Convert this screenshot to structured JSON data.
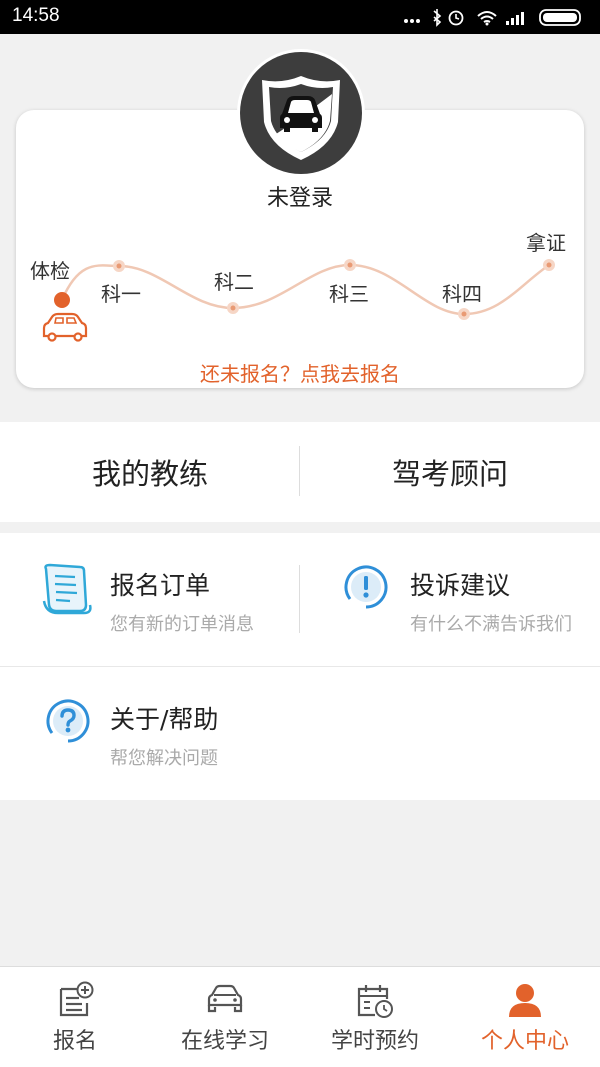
{
  "status_bar": {
    "time": "14:58"
  },
  "profile": {
    "login_status": "未登录",
    "signup_prompt": "还未报名？点我去报名"
  },
  "progress": {
    "stages": [
      "体检",
      "科一",
      "科二",
      "科三",
      "科四",
      "拿证"
    ],
    "current_stage_index": 0
  },
  "quick_buttons": {
    "coach": "我的教练",
    "advisor": "驾考顾问"
  },
  "menu": {
    "orders": {
      "title": "报名订单",
      "subtitle": "您有新的订单消息"
    },
    "complaints": {
      "title": "投诉建议",
      "subtitle": "有什么不满告诉我们"
    },
    "help": {
      "title": "关于/帮助",
      "subtitle": "帮您解决问题"
    }
  },
  "tabs": [
    {
      "label": "报名",
      "icon": "signup-doc-icon"
    },
    {
      "label": "在线学习",
      "icon": "car-icon"
    },
    {
      "label": "学时预约",
      "icon": "calendar-clock-icon"
    },
    {
      "label": "个人中心",
      "icon": "person-icon"
    }
  ],
  "active_tab_index": 3,
  "colors": {
    "accent": "#e2622b",
    "progress_line": "#f0c8b4",
    "info_blue": "#2f8fd8"
  }
}
